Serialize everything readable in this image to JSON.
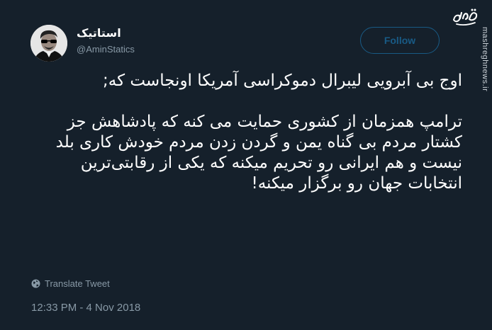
{
  "tweet": {
    "display_name": "استاتیک",
    "handle": "@AminStatics",
    "follow_label": "Follow",
    "paragraph_1": "اوج بی آبرویی لیبرال دموکراسی آمریکا اونجاست که;",
    "paragraph_2": "ترامپ همزمان از کشوری حمایت می کنه که پادشاهش جز کشتار مردم بی گناه یمن و گردن زدن مردم خودش کاری بلد نیست و هم ایرانی رو تحریم میکنه که یکی از رقابتی‌ترین انتخابات جهان رو برگزار میکنه!",
    "translate_label": "Translate Tweet",
    "timestamp": "12:33 PM - 4 Nov 2018"
  },
  "watermark": {
    "logo_text": "مشرق",
    "url": "mashreghnews.ir"
  },
  "icons": {
    "avatar": "profile-photo",
    "translate": "globe-icon"
  },
  "colors": {
    "background": "#15202b",
    "accent": "#1da1f2",
    "secondary_text": "#8899a6"
  }
}
